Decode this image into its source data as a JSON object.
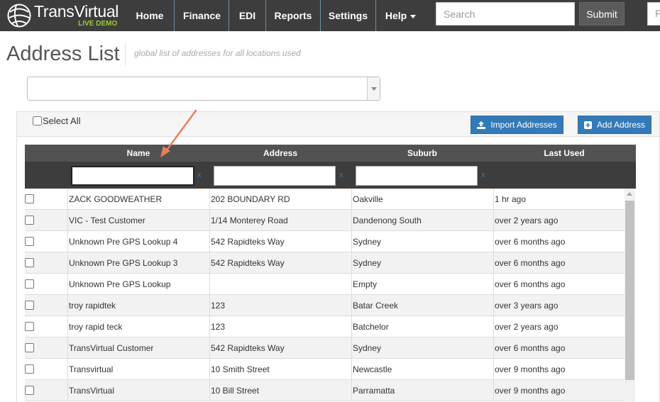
{
  "brand": {
    "name": "TransVirtual",
    "tagline": "LIVE DEMO"
  },
  "nav": {
    "items": [
      {
        "label": "Home"
      },
      {
        "label": "Finance"
      },
      {
        "label": "EDI"
      },
      {
        "label": "Reports"
      },
      {
        "label": "Settings"
      },
      {
        "label": "Help"
      }
    ],
    "search_placeholder": "Search",
    "submit_label": "Submit",
    "extra_input_text": "F"
  },
  "page": {
    "title": "Address List",
    "subtitle": "global list of addresses for all locations used",
    "location_select_value": ""
  },
  "toolbar": {
    "select_all_label": "Select All",
    "import_label": "Import Addresses",
    "add_label": "Add Address"
  },
  "table": {
    "columns": [
      "Name",
      "Address",
      "Suburb",
      "Last Used"
    ],
    "filter_clear": "x",
    "rows": [
      {
        "name": "ZACK GOODWEATHER",
        "address": "202 BOUNDARY RD",
        "suburb": "Oakville",
        "last_used": "1 hr ago"
      },
      {
        "name": "VIC - Test Customer",
        "address": "1/14 Monterey Road",
        "suburb": "Dandenong South",
        "last_used": "over 2 years ago"
      },
      {
        "name": "Unknown Pre GPS Lookup 4",
        "address": "542 Rapidteks Way",
        "suburb": "Sydney",
        "last_used": "over 6 months ago"
      },
      {
        "name": "Unknown Pre GPS Lookup 3",
        "address": "542 Rapidteks Way",
        "suburb": "Sydney",
        "last_used": "over 6 months ago"
      },
      {
        "name": "Unknown Pre GPS Lookup",
        "address": "",
        "suburb": "Empty",
        "last_used": "over 6 months ago"
      },
      {
        "name": "troy rapidtek",
        "address": "123",
        "suburb": "Batar Creek",
        "last_used": "over 3 years ago"
      },
      {
        "name": "troy rapid teck",
        "address": "123",
        "suburb": "Batchelor",
        "last_used": "over 2 years ago"
      },
      {
        "name": "TransVirtual Customer",
        "address": "542 Rapidteks Way",
        "suburb": "Sydney",
        "last_used": "over 6 months ago"
      },
      {
        "name": "Transvirtual",
        "address": "10 Smith Street",
        "suburb": "Newcastle",
        "last_used": "over 9 months ago"
      },
      {
        "name": "TransVirtual",
        "address": "10 Bill Street",
        "suburb": "Parramatta",
        "last_used": "over 9 months ago"
      }
    ]
  },
  "colors": {
    "navbar": "#3d3d3d",
    "accent_green": "#9acd32",
    "button_blue": "#337ab7",
    "table_header": "#525252",
    "filter_row": "#3d3d3d",
    "annotation_arrow": "#e8805a"
  },
  "icons": {
    "brand": "globe-logo-icon",
    "help": "caret-down-icon",
    "import": "upload-icon",
    "add": "plus-square-icon",
    "select": "chevron-down-icon",
    "annotation": "arrow-icon"
  }
}
